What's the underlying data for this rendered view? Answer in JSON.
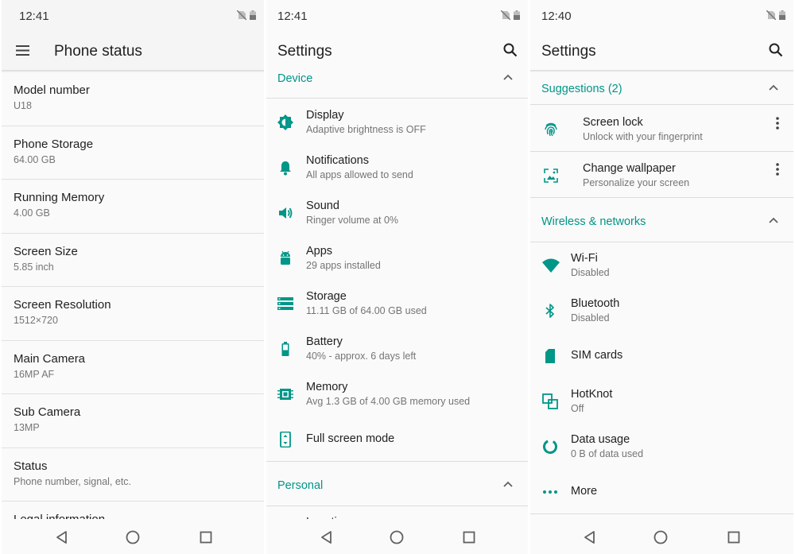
{
  "accent": "#009688",
  "panel1": {
    "status_time": "12:41",
    "title": "Phone status",
    "items": [
      {
        "title": "Model number",
        "sub": "U18"
      },
      {
        "title": "Phone Storage",
        "sub": "64.00 GB"
      },
      {
        "title": "Running Memory",
        "sub": "4.00 GB"
      },
      {
        "title": "Screen Size",
        "sub": "5.85 inch"
      },
      {
        "title": "Screen Resolution",
        "sub": "1512×720"
      },
      {
        "title": "Main Camera",
        "sub": "16MP AF"
      },
      {
        "title": "Sub Camera",
        "sub": "13MP"
      },
      {
        "title": "Status",
        "sub": "Phone number, signal, etc."
      },
      {
        "title": "Legal information",
        "sub": ""
      }
    ]
  },
  "panel2": {
    "status_time": "12:41",
    "title": "Settings",
    "device_header": "Device",
    "personal_header": "Personal",
    "partial_item": "Location",
    "items": [
      {
        "icon": "brightness-icon",
        "title": "Display",
        "sub": "Adaptive brightness is OFF"
      },
      {
        "icon": "bell-icon",
        "title": "Notifications",
        "sub": "All apps allowed to send"
      },
      {
        "icon": "volume-icon",
        "title": "Sound",
        "sub": "Ringer volume at 0%"
      },
      {
        "icon": "android-icon",
        "title": "Apps",
        "sub": "29 apps installed"
      },
      {
        "icon": "storage-icon",
        "title": "Storage",
        "sub": "11.11 GB of 64.00 GB used"
      },
      {
        "icon": "battery-icon",
        "title": "Battery",
        "sub": "40% - approx. 6 days left"
      },
      {
        "icon": "memory-icon",
        "title": "Memory",
        "sub": "Avg 1.3 GB of 4.00 GB memory used"
      },
      {
        "icon": "fullscreen-icon",
        "title": "Full screen mode",
        "sub": ""
      }
    ]
  },
  "panel3": {
    "status_time": "12:40",
    "title": "Settings",
    "suggestions_header": "Suggestions (2)",
    "wireless_header": "Wireless & networks",
    "suggestions": [
      {
        "icon": "fingerprint-icon",
        "title": "Screen lock",
        "sub": "Unlock with your fingerprint"
      },
      {
        "icon": "wallpaper-icon",
        "title": "Change wallpaper",
        "sub": "Personalize your screen"
      }
    ],
    "items": [
      {
        "icon": "wifi-icon",
        "title": "Wi-Fi",
        "sub": "Disabled"
      },
      {
        "icon": "bluetooth-icon",
        "title": "Bluetooth",
        "sub": "Disabled"
      },
      {
        "icon": "sim-card-icon",
        "title": "SIM cards",
        "sub": ""
      },
      {
        "icon": "hotknot-icon",
        "title": "HotKnot",
        "sub": "Off"
      },
      {
        "icon": "data-usage-icon",
        "title": "Data usage",
        "sub": "0 B of data used"
      },
      {
        "icon": "more-icon",
        "title": "More",
        "sub": ""
      }
    ]
  }
}
